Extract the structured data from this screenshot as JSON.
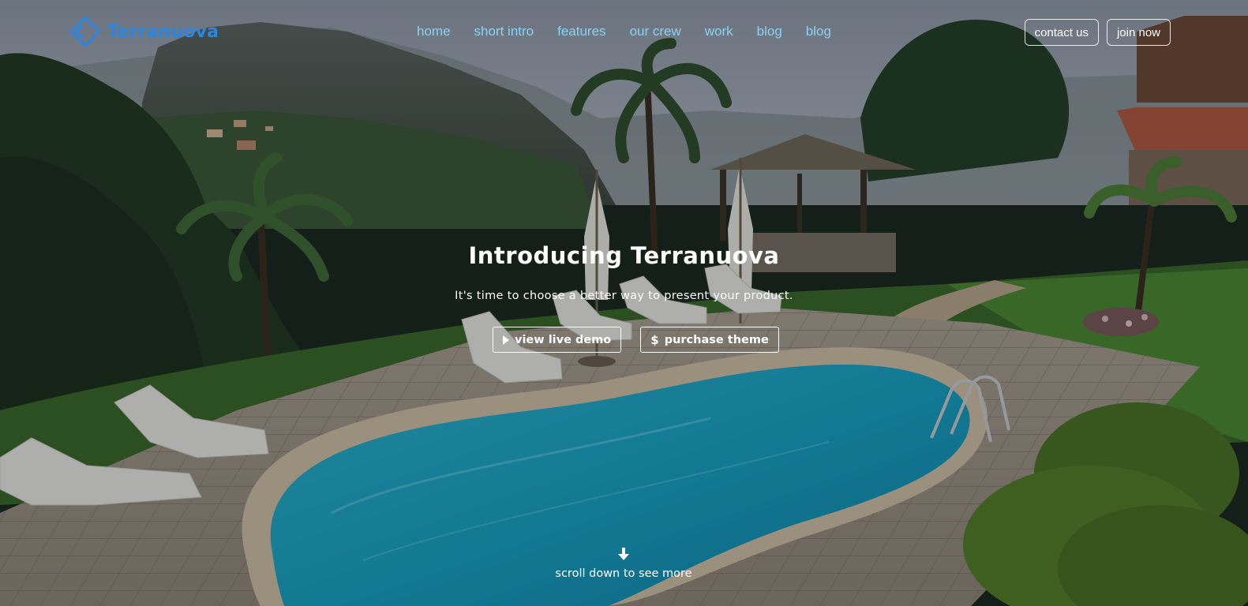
{
  "brand": {
    "name": "Terranuova",
    "logo_icon": "diamond-chevron-icon",
    "color": "#2a86e0"
  },
  "nav": {
    "link_color": "#8fd0f2",
    "items": [
      {
        "label": "home"
      },
      {
        "label": "short intro"
      },
      {
        "label": "features"
      },
      {
        "label": "our crew"
      },
      {
        "label": "work"
      },
      {
        "label": "blog"
      },
      {
        "label": "blog"
      }
    ]
  },
  "header_actions": {
    "contact_label": "contact us",
    "join_label": "join now"
  },
  "hero": {
    "title": "Introducing Terranuova",
    "subtitle": "It's time to choose a better way to present your product.",
    "demo_label": "view live demo",
    "demo_icon": "play-icon",
    "purchase_label": "purchase theme",
    "purchase_icon": "dollar-icon",
    "scroll_label": "scroll down to see more",
    "scroll_icon": "arrow-down-icon"
  }
}
